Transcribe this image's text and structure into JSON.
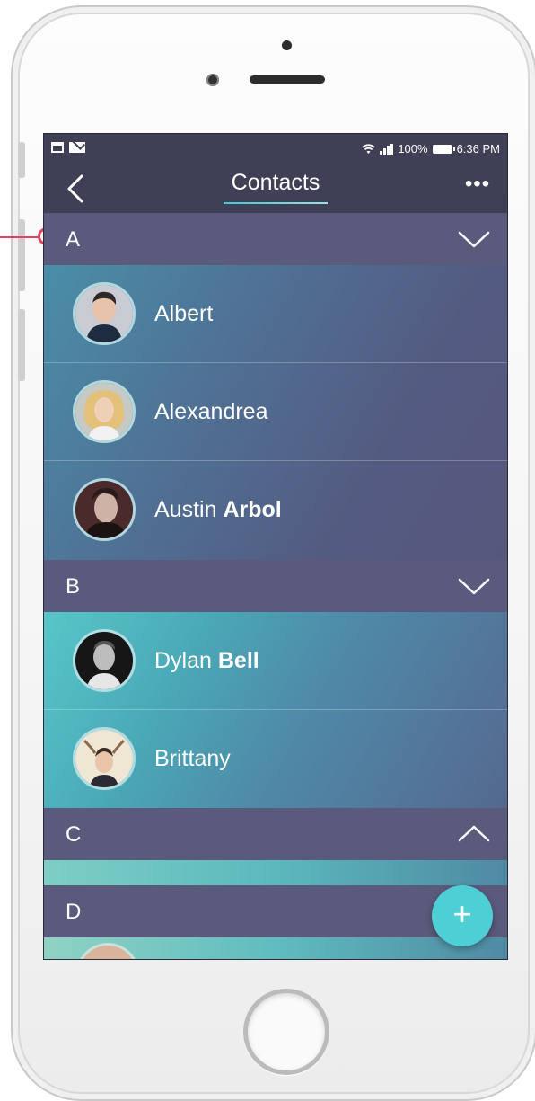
{
  "statusbar": {
    "battery_text": "100%",
    "time": "6:36 PM",
    "left_icons": [
      "calendar-icon",
      "mail-icon"
    ],
    "right_icons": [
      "wifi-icon",
      "signal-icon",
      "battery-icon"
    ]
  },
  "navbar": {
    "title": "Contacts",
    "back_icon": "chevron-left-icon",
    "more_icon": "more-horizontal-icon",
    "more_glyph": "•••"
  },
  "sections": [
    {
      "letter": "A",
      "state": "expanded",
      "contacts": [
        {
          "first": "Albert",
          "last": ""
        },
        {
          "first": "Alexandrea",
          "last": ""
        },
        {
          "first": "Austin",
          "last": "Arbol"
        }
      ]
    },
    {
      "letter": "B",
      "state": "expanded",
      "contacts": [
        {
          "first": "Dylan",
          "last": "Bell"
        },
        {
          "first": "Brittany",
          "last": ""
        }
      ]
    },
    {
      "letter": "C",
      "state": "collapsed",
      "contacts": []
    },
    {
      "letter": "D",
      "state": "expanded",
      "contacts": []
    }
  ],
  "fab": {
    "label": "+",
    "icon": "plus-icon"
  },
  "colors": {
    "header_bg": "#3f3f55",
    "section_bg": "#5a5a7c",
    "accent": "#4ecfd6",
    "callout": "#e0455d"
  }
}
